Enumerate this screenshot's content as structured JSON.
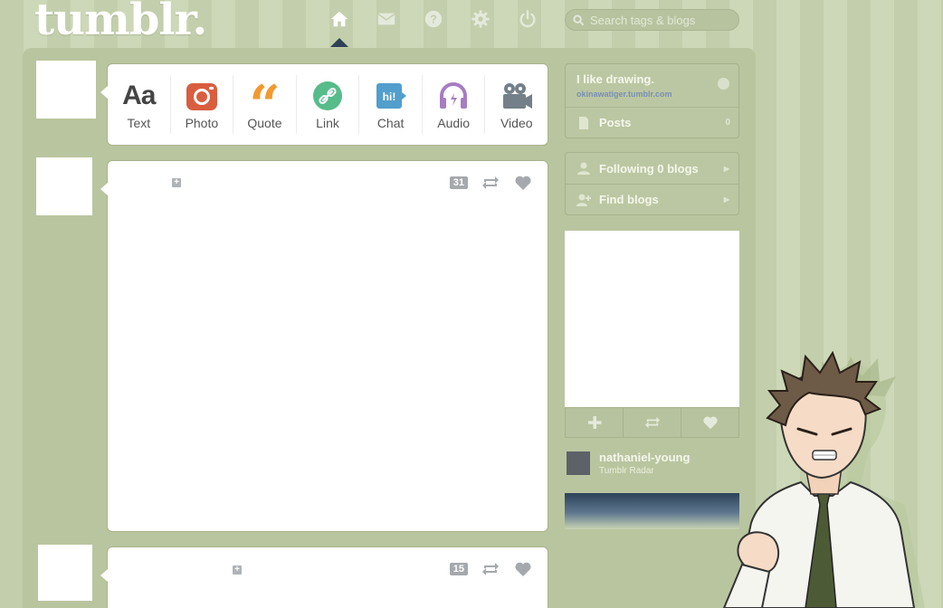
{
  "brand": {
    "logo_text": "tumblr."
  },
  "nav": {
    "items": [
      {
        "name": "home",
        "icon": "home-icon",
        "active": true
      },
      {
        "name": "messages",
        "icon": "envelope-icon",
        "active": false
      },
      {
        "name": "help",
        "icon": "question-icon",
        "active": false
      },
      {
        "name": "settings",
        "icon": "gear-icon",
        "active": false
      },
      {
        "name": "logout",
        "icon": "power-icon",
        "active": false
      }
    ]
  },
  "search": {
    "placeholder": "Search tags & blogs"
  },
  "post_types": [
    {
      "label": "Text",
      "icon": "text-aa-icon",
      "glyph": "Aa",
      "color": "#444444"
    },
    {
      "label": "Photo",
      "icon": "camera-icon",
      "color": "#d95e40"
    },
    {
      "label": "Quote",
      "icon": "quote-icon",
      "glyph": "“",
      "color": "#f2992e"
    },
    {
      "label": "Link",
      "icon": "link-icon",
      "color": "#56bc8a"
    },
    {
      "label": "Chat",
      "icon": "chat-icon",
      "glyph": "hi!",
      "color": "#529ecc"
    },
    {
      "label": "Audio",
      "icon": "headphones-icon",
      "color": "#a77dc2"
    },
    {
      "label": "Video",
      "icon": "video-camera-icon",
      "color": "#748089"
    }
  ],
  "posts": [
    {
      "notes": "31"
    },
    {
      "notes": "15"
    }
  ],
  "sidebar": {
    "blog": {
      "title": "I like drawing.",
      "url": "okinawatiger.tumblr.com"
    },
    "posts": {
      "label": "Posts",
      "count": "0"
    },
    "following": {
      "label": "Following 0 blogs"
    },
    "find": {
      "label": "Find blogs"
    },
    "radar": {
      "username": "nathaniel-young",
      "subtitle": "Tumblr Radar"
    }
  },
  "colors": {
    "background": "#c6d1af",
    "dashboard": "#b9c59f",
    "caret": "#2f4156",
    "note_badge": "#a5a9ad"
  }
}
